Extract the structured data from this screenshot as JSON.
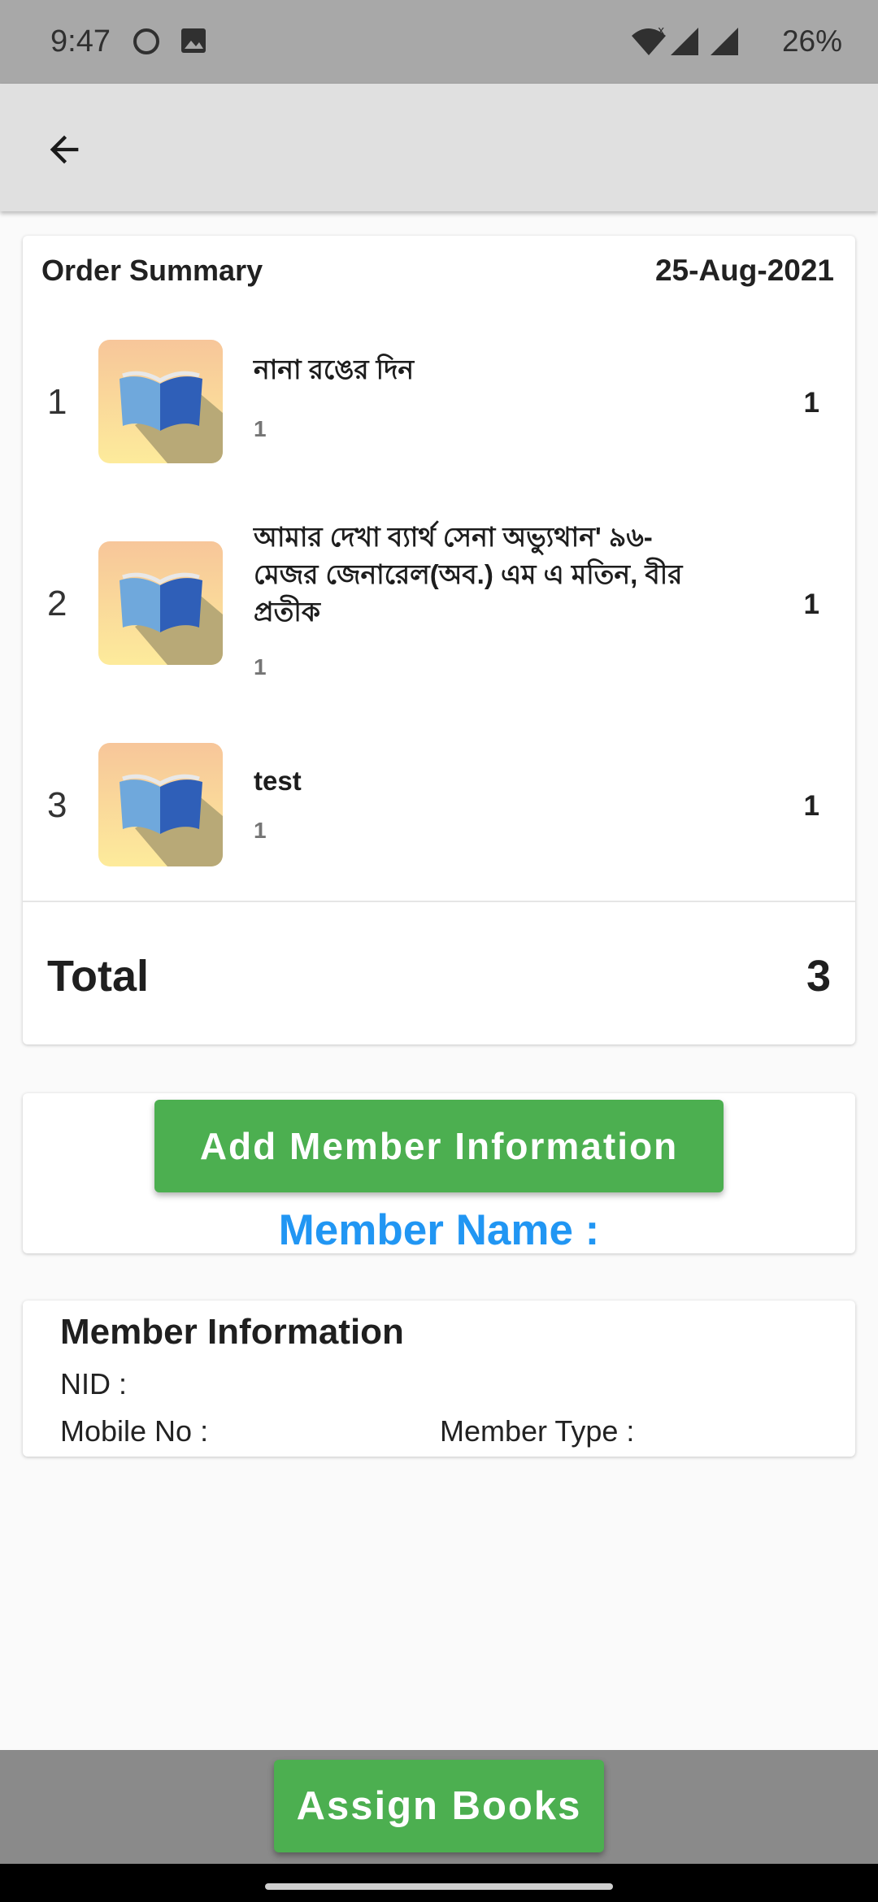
{
  "status_bar": {
    "time": "9:47",
    "battery": "26%"
  },
  "app_bar": {
    "back_icon": "arrow-back-icon"
  },
  "order_summary": {
    "title": "Order Summary",
    "date": "25-Aug-2021",
    "items": [
      {
        "index": "1",
        "title": "নানা রঙের দিন",
        "sub": "1",
        "qty": "1"
      },
      {
        "index": "2",
        "title": "আমার দেখা ব্যার্থ সেনা অভ্যুথান' ৯৬-মেজর জেনারেল(অব.) এম এ মতিন, বীর প্রতীক",
        "sub": "1",
        "qty": "1"
      },
      {
        "index": "3",
        "title": "test",
        "sub": "1",
        "qty": "1"
      }
    ],
    "total_label": "Total",
    "total_value": "3"
  },
  "member": {
    "add_button": "Add Member Information",
    "name_label": "Member Name :"
  },
  "member_info": {
    "title": "Member Information",
    "nid_label": "NID :",
    "mobile_label": "Mobile No :",
    "type_label": "Member Type :"
  },
  "footer": {
    "assign_button": "Assign Books"
  },
  "colors": {
    "accent_green": "#4caf50",
    "member_name_blue": "#2196f3"
  }
}
